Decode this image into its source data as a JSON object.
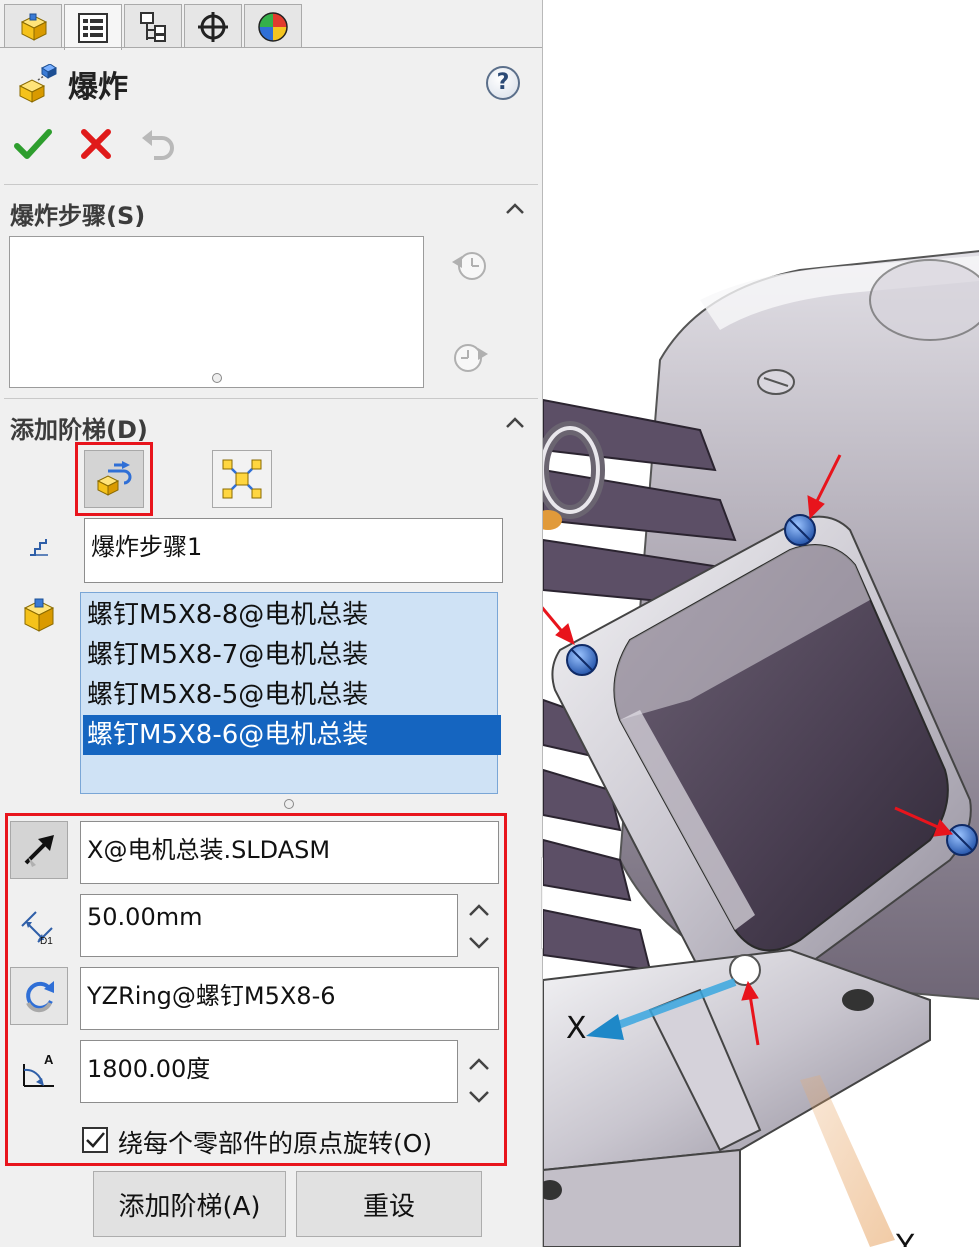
{
  "panel": {
    "title": "爆炸",
    "help": "?",
    "tabs": [
      "feature-manager-icon",
      "property-manager-icon",
      "configuration-manager-icon",
      "dimxpert-icon",
      "display-manager-icon"
    ],
    "active_tab": 1
  },
  "actions": {
    "ok": "check-icon",
    "cancel": "x-icon",
    "undo": "undo-icon"
  },
  "explode_steps": {
    "heading": "爆炸步骤(S)"
  },
  "add_step": {
    "heading": "添加阶梯(D)",
    "step_name": "爆炸步骤1",
    "components": [
      "螺钉M5X8-8@电机总装",
      "螺钉M5X8-7@电机总装",
      "螺钉M5X8-5@电机总装",
      "螺钉M5X8-6@电机总装"
    ],
    "selected_index": 3,
    "direction": "X@电机总装.SLDASM",
    "distance": "50.00mm",
    "rotation_axis": "YZRing@螺钉M5X8-6",
    "rotation_angle": "1800.00度",
    "rotate_about_origin_label": "绕每个零部件的原点旋转(O)",
    "rotate_about_origin_checked": true,
    "dim_badge": "D1",
    "angle_badge": "A"
  },
  "buttons": {
    "add_step": "添加阶梯(A)",
    "reset": "重设"
  },
  "viewport": {
    "x_label": "X",
    "y_label": "Y"
  },
  "colors": {
    "highlight": "#e8141c",
    "selection": "#1565c0",
    "accent_green": "#2e9e2e"
  }
}
